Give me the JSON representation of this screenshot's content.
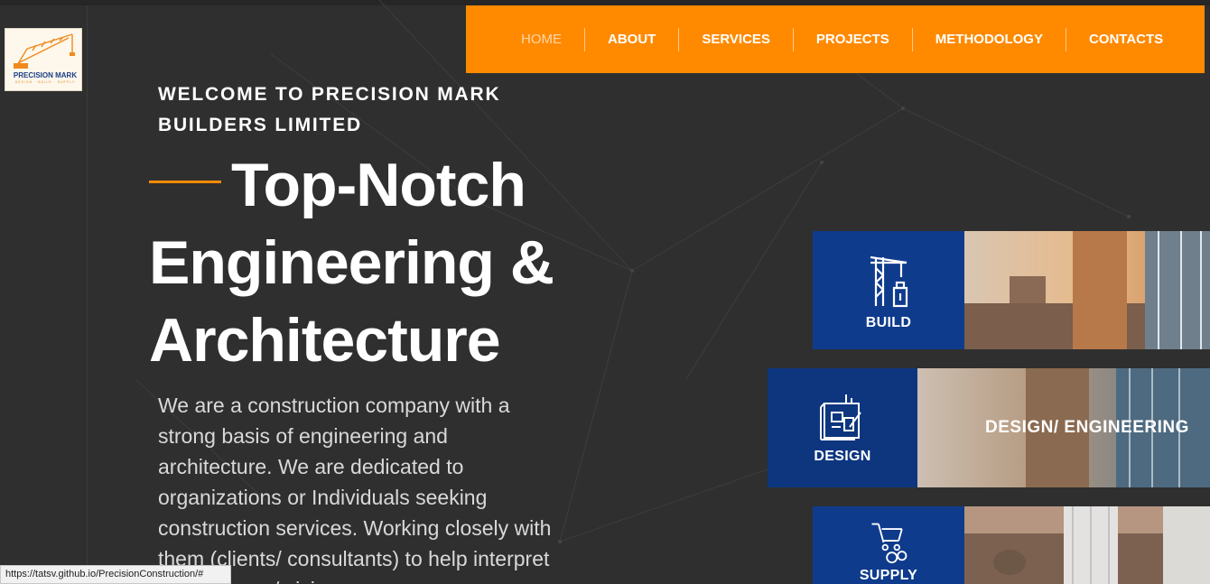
{
  "brand": {
    "name": "PRECISION MARK",
    "sub": "DESIGN · BUILD · SUPPLY",
    "colors": {
      "accent": "#ff8a00",
      "blue": "#0f3b8c",
      "background": "#2f2f2f"
    }
  },
  "nav": {
    "items": [
      {
        "label": "HOME",
        "active": true
      },
      {
        "label": "ABOUT",
        "active": false
      },
      {
        "label": "SERVICES",
        "active": false
      },
      {
        "label": "PROJECTS",
        "active": false
      },
      {
        "label": "METHODOLOGY",
        "active": false
      },
      {
        "label": "CONTACTS",
        "active": false
      }
    ]
  },
  "hero": {
    "welcome": "WELCOME TO PRECISION MARK BUILDERS LIMITED",
    "headline_1": "Top-Notch",
    "headline_2": "Engineering &",
    "headline_3": "Architecture",
    "paragraph": "We are a construction company with a strong basis of engineering and architecture. We are dedicated to organizations or Individuals seeking construction services. Working closely with them (clients/ consultants) to help interpret their dreams/ vision"
  },
  "services": {
    "build": {
      "label": "BUILD",
      "icon": "crane-icon"
    },
    "design": {
      "label": "DESIGN",
      "overlay": "DESIGN/ ENGINEERING",
      "icon": "blueprint-icon"
    },
    "supply": {
      "label": "SUPPLY",
      "icon": "supply-cart-icon"
    }
  },
  "statusbar": {
    "url": "https://tatsv.github.io/PrecisionConstruction/#"
  }
}
